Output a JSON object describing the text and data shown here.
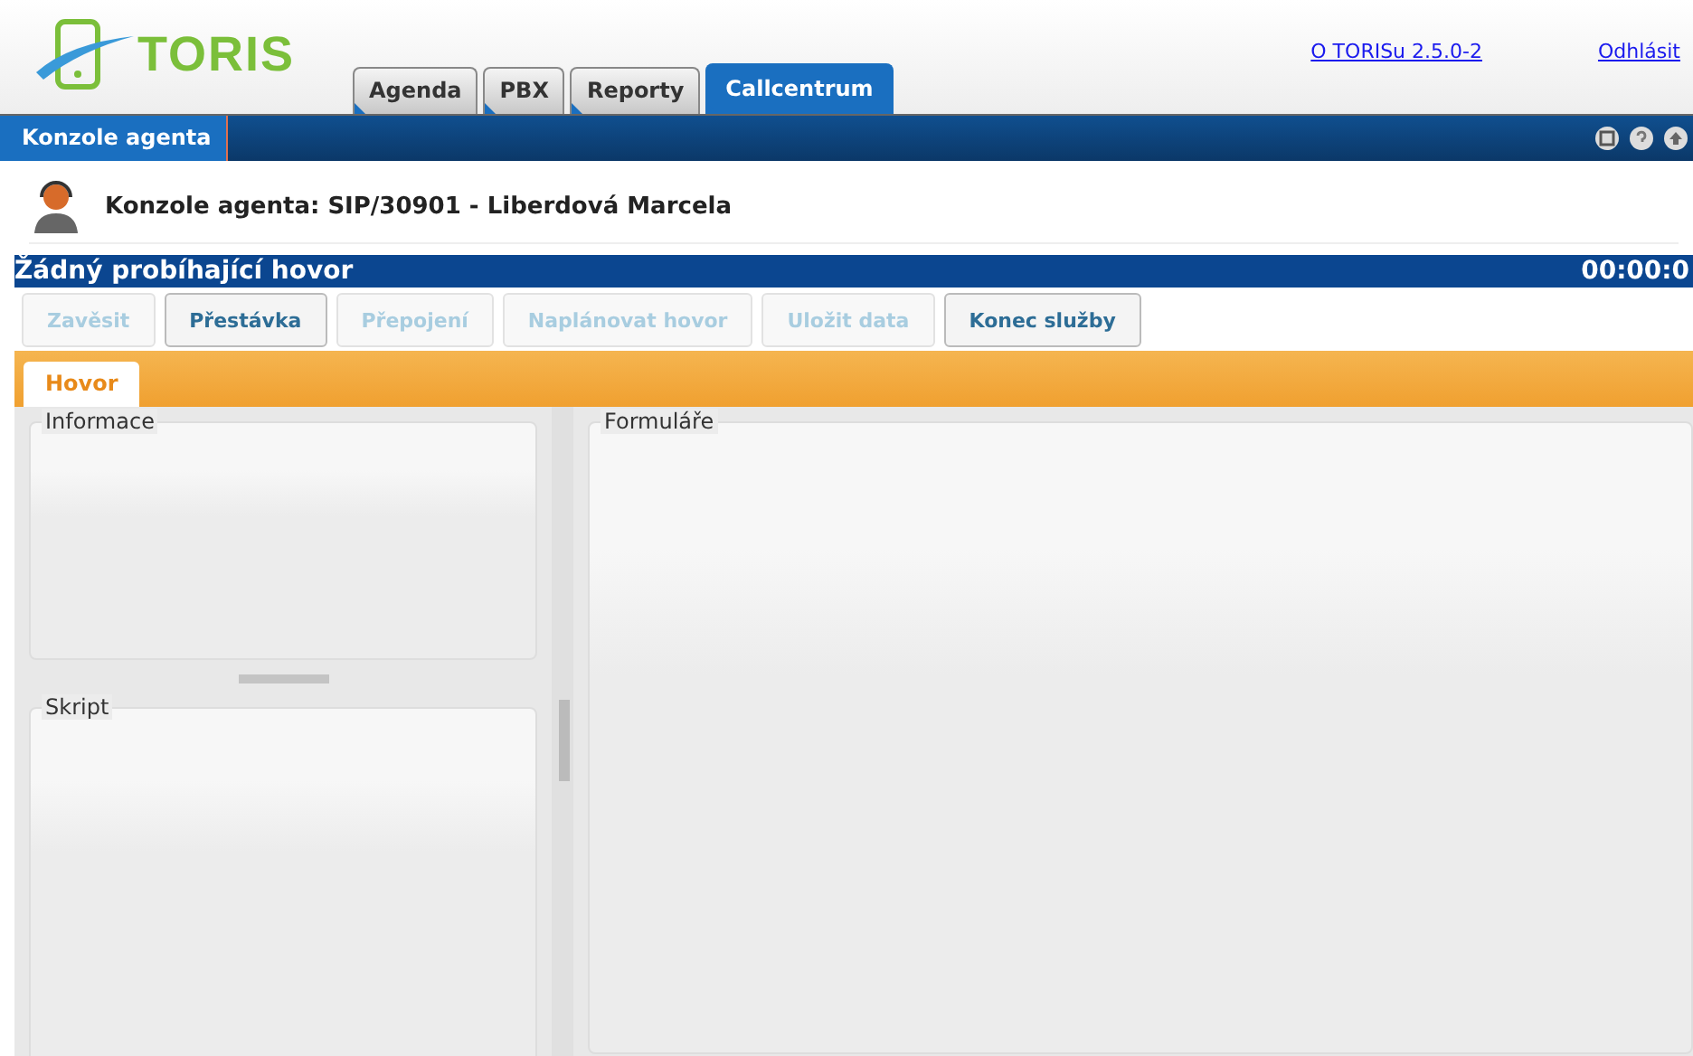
{
  "logo": {
    "text": "TORIS"
  },
  "tabs": [
    {
      "label": "Agenda",
      "selected": false
    },
    {
      "label": "PBX",
      "selected": false
    },
    {
      "label": "Reporty",
      "selected": false
    },
    {
      "label": "Callcentrum",
      "selected": true
    }
  ],
  "links": [
    "O TORISu 2.5.0-2",
    "Odhlásit"
  ],
  "subnav": [
    {
      "label": "Konzole agenta",
      "selected": true
    }
  ],
  "agent": {
    "title": "Konzole agenta: SIP/30901 - Liberdová Marcela"
  },
  "call": {
    "status": "Žádný probíhající hovor",
    "timer": "00:00:0"
  },
  "buttons": [
    {
      "label": "Zavěsit",
      "disabled": true
    },
    {
      "label": "Přestávka",
      "disabled": false
    },
    {
      "label": "Přepojení",
      "disabled": true
    },
    {
      "label": "Naplánovat hovor",
      "disabled": true
    },
    {
      "label": "Uložit data",
      "disabled": true
    },
    {
      "label": "Konec služby",
      "disabled": false
    }
  ],
  "call_tabs": [
    {
      "label": "Hovor",
      "selected": true
    }
  ],
  "panels": {
    "left": [
      "Informace",
      "Skript"
    ],
    "right": "Formuláře"
  }
}
